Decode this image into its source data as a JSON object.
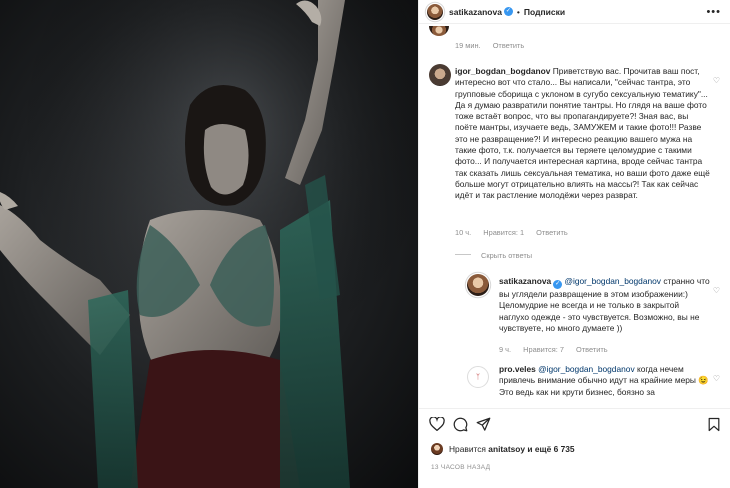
{
  "post": {
    "author": "satikazanova",
    "follow_label": "Подписки",
    "separator": "•",
    "more_icon": "ellipsis-icon"
  },
  "comments": {
    "first_meta": {
      "time": "19 мин.",
      "reply": "Ответить"
    },
    "igor": {
      "username": "igor_bogdan_bogdanov",
      "text": "Приветствую вас. Прочитав ваш пост, интересно вот что стало... Вы написали, \"сейчас тантра, это групповые сборища с уклоном в сугубо сексуальную тематику\"... Да я думаю развратили понятие тантры. Но глядя на ваше фото тоже встаёт вопрос, что вы пропагандируете?! Зная вас, вы поёте мантры, изучаете ведь, ЗАМУЖЕМ и такие фото!!! Разве это не развращение?! И интересно реакцию вашего мужа на такие фото, т.к. получается вы теряете целомудрие с такими фото... И получается интересная картина, вроде сейчас тантра так сказать лишь сексуальная тематика, но ваши фото даже ещё больше могут отрицательно влиять на массы?! Так как сейчас идёт и так растление молодёжи через разврат.",
      "time": "10 ч.",
      "likes": "Нравится: 1",
      "reply": "Ответить",
      "hide_replies": "Скрыть ответы"
    },
    "sati_reply": {
      "username": "satikazanova",
      "mention": "@igor_bogdan_bogdanov",
      "text": " странно что вы углядели развращение в этом изображении:) Целомудрие не всегда и не только в закрытой наглухо одежде - это чувствуется. Возможно, вы не чувствуете, но много думаете ))",
      "time": "9 ч.",
      "likes": "Нравится: 7",
      "reply": "Ответить"
    },
    "pro": {
      "username": "pro.veles",
      "mention": "@igor_bogdan_bogdanov",
      "text_1": " когда нечем привлечь внимание обычно идут на крайние меры",
      "emoji": "😉",
      "text_2": " Это ведь как ни крути бизнес, боязно за"
    }
  },
  "actions": {
    "like_icon": "heart-icon",
    "comment_icon": "comment-icon",
    "share_icon": "paper-plane-icon",
    "save_icon": "bookmark-icon"
  },
  "likes": {
    "prefix": "Нравится",
    "user": "anitatsoy",
    "suffix": "и ещё 6 735"
  },
  "timestamp": "13 ЧАСОВ НАЗАД",
  "colors": {
    "verified": "#3897f0",
    "mention": "#00376b",
    "muted": "#8e8e8e"
  }
}
